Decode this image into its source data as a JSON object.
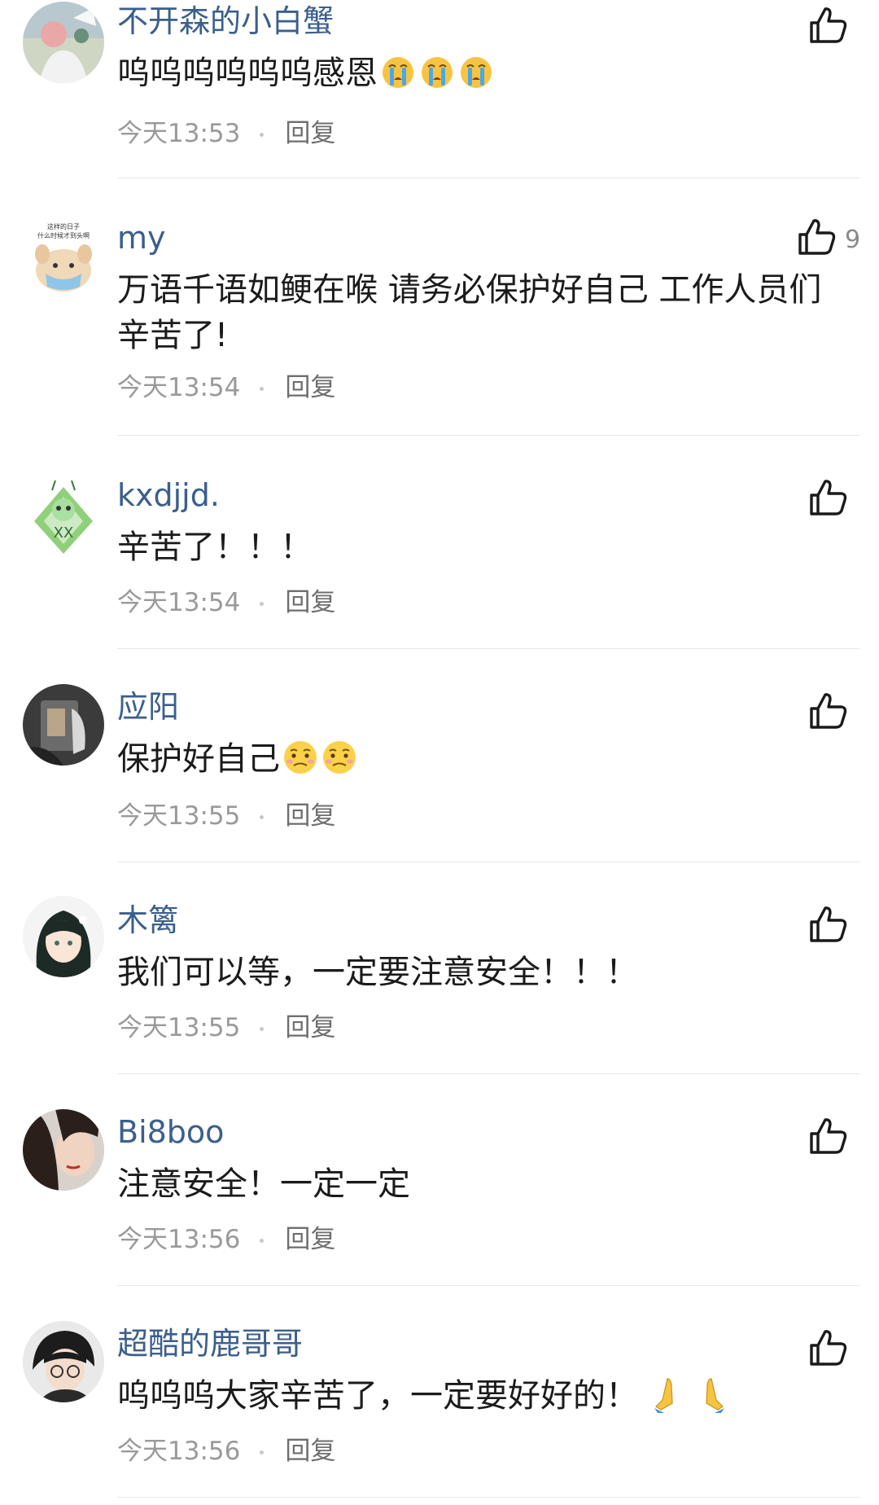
{
  "like_icon": "thumbs-up-icon",
  "colors": {
    "username": "#3b5f8c",
    "meta": "#9a9a9a",
    "divider": "#e8e8e8"
  },
  "comments": [
    {
      "username": "不开森的小白蟹",
      "text": "呜呜呜呜呜呜感恩",
      "emojis": [
        "crying-face-icon",
        "crying-face-icon",
        "crying-face-icon"
      ],
      "time": "今天13:53",
      "reply_label": "回复",
      "like_count": ""
    },
    {
      "username": "my",
      "avatar_caption": "这样的日子 什么时候才到头啊",
      "text": "万语千语如鲠在喉 请务必保护好自己 工作人员们辛苦了!",
      "emojis": [],
      "time": "今天13:54",
      "reply_label": "回复",
      "like_count": "9"
    },
    {
      "username": "kxdjjd.",
      "text": "辛苦了！！！",
      "emojis": [],
      "time": "今天13:54",
      "reply_label": "回复",
      "like_count": ""
    },
    {
      "username": "应阳",
      "text": "保护好自己",
      "emojis": [
        "worried-face-icon",
        "worried-face-icon"
      ],
      "time": "今天13:55",
      "reply_label": "回复",
      "like_count": ""
    },
    {
      "username": "木篱",
      "text": "我们可以等，一定要注意安全！！！",
      "emojis": [],
      "time": "今天13:55",
      "reply_label": "回复",
      "like_count": ""
    },
    {
      "username": "Bi8boo",
      "text": "注意安全！一定一定",
      "emojis": [],
      "time": "今天13:56",
      "reply_label": "回复",
      "like_count": ""
    },
    {
      "username": "超酷的鹿哥哥",
      "text": "呜呜呜大家辛苦了，一定要好好的！",
      "emojis": [
        "folded-hands-icon",
        "folded-hands-icon"
      ],
      "time": "今天13:56",
      "reply_label": "回复",
      "like_count": ""
    }
  ]
}
